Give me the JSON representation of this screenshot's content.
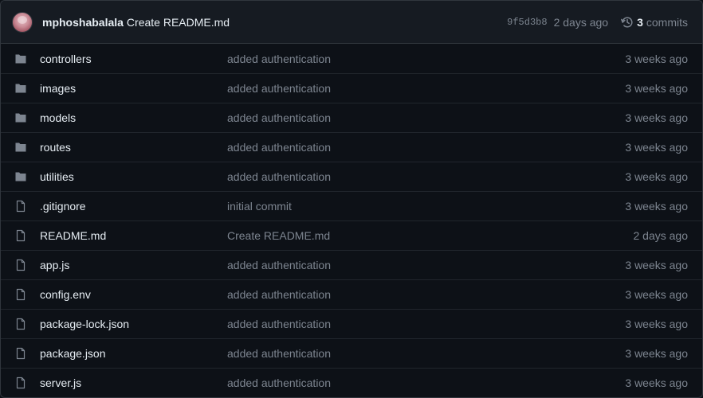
{
  "latest_commit": {
    "author": "mphoshabalala",
    "message": "Create README.md",
    "sha": "9f5d3b8",
    "age": "2 days ago",
    "commit_count": "3",
    "commits_label": "commits"
  },
  "files": [
    {
      "type": "directory",
      "icon": "folder-icon",
      "name": "controllers",
      "commit": "added authentication",
      "age": "3 weeks ago"
    },
    {
      "type": "directory",
      "icon": "folder-icon",
      "name": "images",
      "commit": "added authentication",
      "age": "3 weeks ago"
    },
    {
      "type": "directory",
      "icon": "folder-icon",
      "name": "models",
      "commit": "added authentication",
      "age": "3 weeks ago"
    },
    {
      "type": "directory",
      "icon": "folder-icon",
      "name": "routes",
      "commit": "added authentication",
      "age": "3 weeks ago"
    },
    {
      "type": "directory",
      "icon": "folder-icon",
      "name": "utilities",
      "commit": "added authentication",
      "age": "3 weeks ago"
    },
    {
      "type": "file",
      "icon": "file-icon",
      "name": ".gitignore",
      "commit": "initial commit",
      "age": "3 weeks ago"
    },
    {
      "type": "file",
      "icon": "file-icon",
      "name": "README.md",
      "commit": "Create README.md",
      "age": "2 days ago"
    },
    {
      "type": "file",
      "icon": "file-icon",
      "name": "app.js",
      "commit": "added authentication",
      "age": "3 weeks ago"
    },
    {
      "type": "file",
      "icon": "file-icon",
      "name": "config.env",
      "commit": "added authentication",
      "age": "3 weeks ago"
    },
    {
      "type": "file",
      "icon": "file-icon",
      "name": "package-lock.json",
      "commit": "added authentication",
      "age": "3 weeks ago"
    },
    {
      "type": "file",
      "icon": "file-icon",
      "name": "package.json",
      "commit": "added authentication",
      "age": "3 weeks ago"
    },
    {
      "type": "file",
      "icon": "file-icon",
      "name": "server.js",
      "commit": "added authentication",
      "age": "3 weeks ago"
    }
  ],
  "colors": {
    "background": "#0d1117",
    "header_background": "#161b22",
    "border": "#30363d",
    "text_primary": "#e6edf3",
    "text_muted": "#7d8590"
  }
}
